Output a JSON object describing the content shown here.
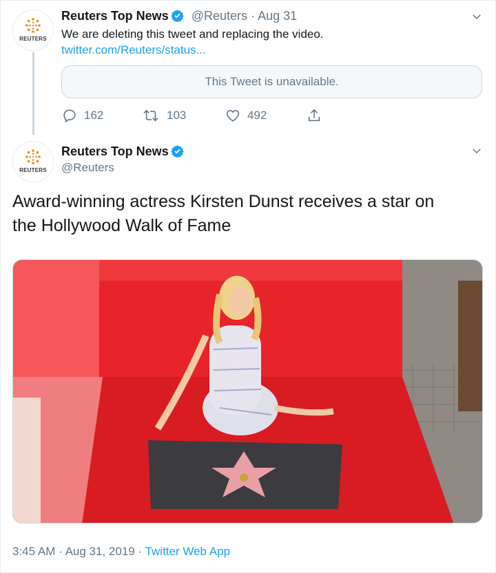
{
  "tweet1": {
    "name": "Reuters Top News",
    "handle": "@Reuters",
    "dot": "·",
    "date": "Aug 31",
    "avatar_text": "REUTERS",
    "text": "We are deleting this tweet and replacing the video.",
    "link": "twitter.com/Reuters/status...",
    "quote_unavailable": "This Tweet is unavailable.",
    "actions": {
      "replies": "162",
      "retweets": "103",
      "likes": "492"
    }
  },
  "tweet2": {
    "name": "Reuters Top News",
    "handle": "@Reuters",
    "avatar_text": "REUTERS",
    "text_line1": "Award-winning actress Kirsten Dunst receives a star on",
    "text_line2": "the Hollywood Walk of Fame",
    "footer": {
      "time": "3:45 AM",
      "dot1": "·",
      "date": "Aug 31, 2019",
      "dot2": "·",
      "source": "Twitter Web App"
    }
  },
  "colors": {
    "accent": "#1da1f2",
    "muted": "#657786",
    "border": "#e6ecf0",
    "reuters_orange": "#f08a1c",
    "carpet_red": "#e8242a"
  },
  "icons": [
    "verified-badge-icon",
    "chevron-down-icon",
    "reply-icon",
    "retweet-icon",
    "like-icon",
    "share-icon"
  ]
}
